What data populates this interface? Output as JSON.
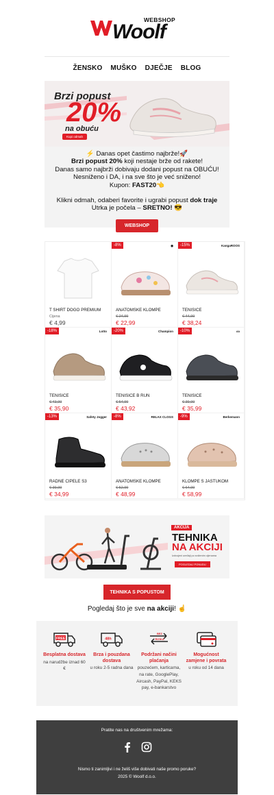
{
  "brand": {
    "webshop": "WEBSHOP",
    "name": "Woolf"
  },
  "nav": [
    "ŽENSKO",
    "MUŠKO",
    "DJEČJE",
    "BLOG"
  ],
  "hero": {
    "line1": "Brzi popust",
    "line2": "20%",
    "line3": "na obuću",
    "button": "Kupi odmah"
  },
  "intro": {
    "line1": "⚡ Danas opet častimo najbrže!🚀",
    "line2_bold": "Brzi popust 20%",
    "line2_rest": " koji nestaje brže od rakete!",
    "line3": "Danas samo najbrži dobivaju dodani popust na OBUĆU!",
    "line4": "Nesniženo i DA, i na sve što je već sniženo!",
    "line5_label": "Kupon: ",
    "line5_code": "FAST20👈",
    "line6_pre": "Klikni odmah, odaberi favorite i ugrabi popust ",
    "line6_bold": "dok traje",
    "line7_pre": "Utrka je počela – ",
    "line7_bold": "SRETNO!",
    "line7_emoji": " 😎",
    "button": "WEBSHOP"
  },
  "products": [
    {
      "name": "T SHIRT DOGO PREMIUM",
      "badge": "",
      "brand": "",
      "old_label": "Cijena",
      "old_price": "",
      "price": "€ 4,99",
      "icon": "tshirt-icon"
    },
    {
      "name": "ANATOMSKE KLOMPE",
      "badge": "-8%",
      "brand": "◉",
      "old_label": "",
      "old_price": "€ 24,99",
      "price": "€ 22,99",
      "icon": "clog-icon"
    },
    {
      "name": "TENISICE",
      "badge": "-15%",
      "brand": "KangaROOS",
      "old_label": "",
      "old_price": "€ 44,99",
      "price": "€ 38,24",
      "icon": "sneaker-icon"
    },
    {
      "name": "TENISICE",
      "badge": "-18%",
      "brand": "Lotto",
      "old_label": "",
      "old_price": "€ 43,99",
      "price": "€ 35,90",
      "icon": "sneaker-icon"
    },
    {
      "name": "TENISICE B RUN",
      "badge": "-20%",
      "brand": "Champion",
      "old_label": "",
      "old_price": "€ 54,99",
      "price": "€ 43,92",
      "icon": "sneaker-icon"
    },
    {
      "name": "TENISICE",
      "badge": "-10%",
      "brand": "ʌʌ",
      "old_label": "",
      "old_price": "€ 39,99",
      "price": "€ 35,99",
      "icon": "sneaker-icon"
    },
    {
      "name": "RADNE CIPELE S3",
      "badge": "-13%",
      "brand": "Safety Jogger",
      "old_label": "",
      "old_price": "€ 39,99",
      "price": "€ 34,99",
      "icon": "boot-icon"
    },
    {
      "name": "ANATOMSKE KLOMPE",
      "badge": "-8%",
      "brand": "RELAX CLOGS",
      "old_label": "",
      "old_price": "€ 52,99",
      "price": "€ 48,99",
      "icon": "clog-icon"
    },
    {
      "name": "KLOMPE S JASTUKOM",
      "badge": "-9%",
      "brand": "Berkemann",
      "old_label": "",
      "old_price": "€ 64,99",
      "price": "€ 58,99",
      "icon": "clog-icon"
    }
  ],
  "banner2": {
    "tag": "AKCIJA",
    "title1": "TEHNIKA",
    "title2": "NA AKCIJI",
    "subtitle": "Izdvojeni uređaji po sniženim cijenama",
    "button": "POGLEDAJ PONUDU"
  },
  "tech_button": "TEHNIKA S POPUSTOM",
  "akcija": {
    "pre": "Pogledaj što je sve ",
    "bold": "na akciji",
    "post": "! ☝"
  },
  "usp": [
    {
      "title": "Besplatna dostava",
      "desc": "na narudžbe iznad 60 €",
      "icon": "truck-free-icon",
      "icon_label": "FREE"
    },
    {
      "title": "Brza i pouzdana dostava",
      "desc": "u roku 2-5 radna dana",
      "icon": "truck-48h-icon",
      "icon_label": "48h"
    },
    {
      "title": "Podržani načini plaćanja",
      "desc": "pouzećem, karticama, na rate, GooglePlay, Aircash, PayPal, KEKS pay, e-bankarstvo",
      "icon": "no-risk-icon",
      "icon_label": "BEZ RIZIKA"
    },
    {
      "title": "Mogućnost zamjene i povrata",
      "desc": "u roku od 14 dana",
      "icon": "cards-icon",
      "icon_label": ""
    }
  ],
  "footer": {
    "follow": "Pratite nas na društvenim mrežama:",
    "unsubscribe": "Nismo ti zanimljivi i ne želiš više dobivati naše promo poruke?",
    "copyright": "2025 © Woolf d.o.o."
  },
  "colors": {
    "accent": "#e11d27",
    "footer_bg": "#3f3f3f",
    "panel_bg": "#f3f3f3"
  }
}
